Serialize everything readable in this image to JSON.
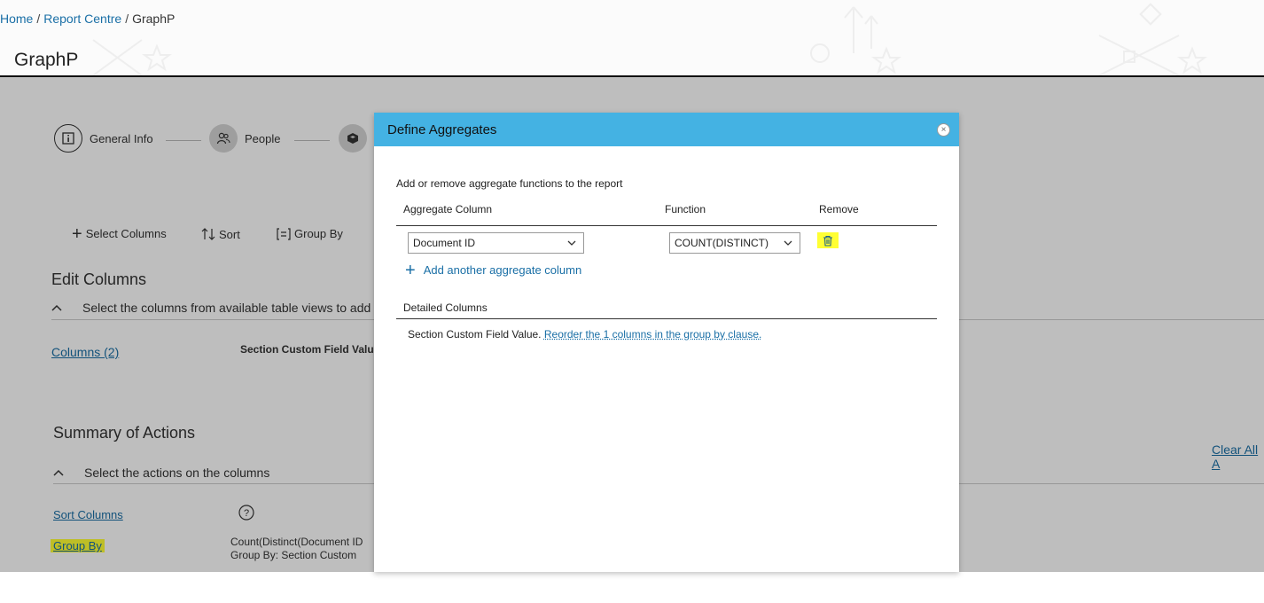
{
  "breadcrumb": {
    "home": "Home",
    "sep1": "/",
    "report_centre": "Report Centre",
    "sep2": "/",
    "current": "GraphP"
  },
  "page_title": "GraphP",
  "steps": [
    {
      "label": "General Info",
      "icon": "info-icon"
    },
    {
      "label": "People",
      "icon": "people-icon"
    },
    {
      "label": "",
      "icon": "cube-icon"
    }
  ],
  "toolbar": {
    "select_columns": "Select Columns",
    "sort": "Sort",
    "group_by": "Group By"
  },
  "edit_columns": {
    "title": "Edit Columns",
    "subtitle": "Select the columns from available table views to add",
    "columns_link": "Columns (2)",
    "column_name": "Section Custom Field Value"
  },
  "summary": {
    "title": "Summary of Actions",
    "subtitle": "Select the actions on the columns",
    "sort_link": "Sort Columns",
    "group_link": "Group By",
    "clear_all": "Clear All A",
    "group_line1": "Count(Distinct(Document ID",
    "group_line2": "Group By: Section Custom"
  },
  "modal": {
    "title": "Define Aggregates",
    "close": "×",
    "intro": "Add or remove aggregate functions to the report",
    "headers": {
      "column": "Aggregate Column",
      "function": "Function",
      "remove": "Remove"
    },
    "row": {
      "column_value": "Document ID",
      "function_value": "COUNT(DISTINCT)"
    },
    "add_link": "Add another aggregate column",
    "detailed_header": "Detailed Columns",
    "detailed_text": "Section Custom Field Value.",
    "reorder_link": "Reorder the 1 columns in the group by clause."
  },
  "colors": {
    "modal_header": "#44b2e3",
    "link": "#1a6fa6",
    "highlight": "#ffff33"
  }
}
